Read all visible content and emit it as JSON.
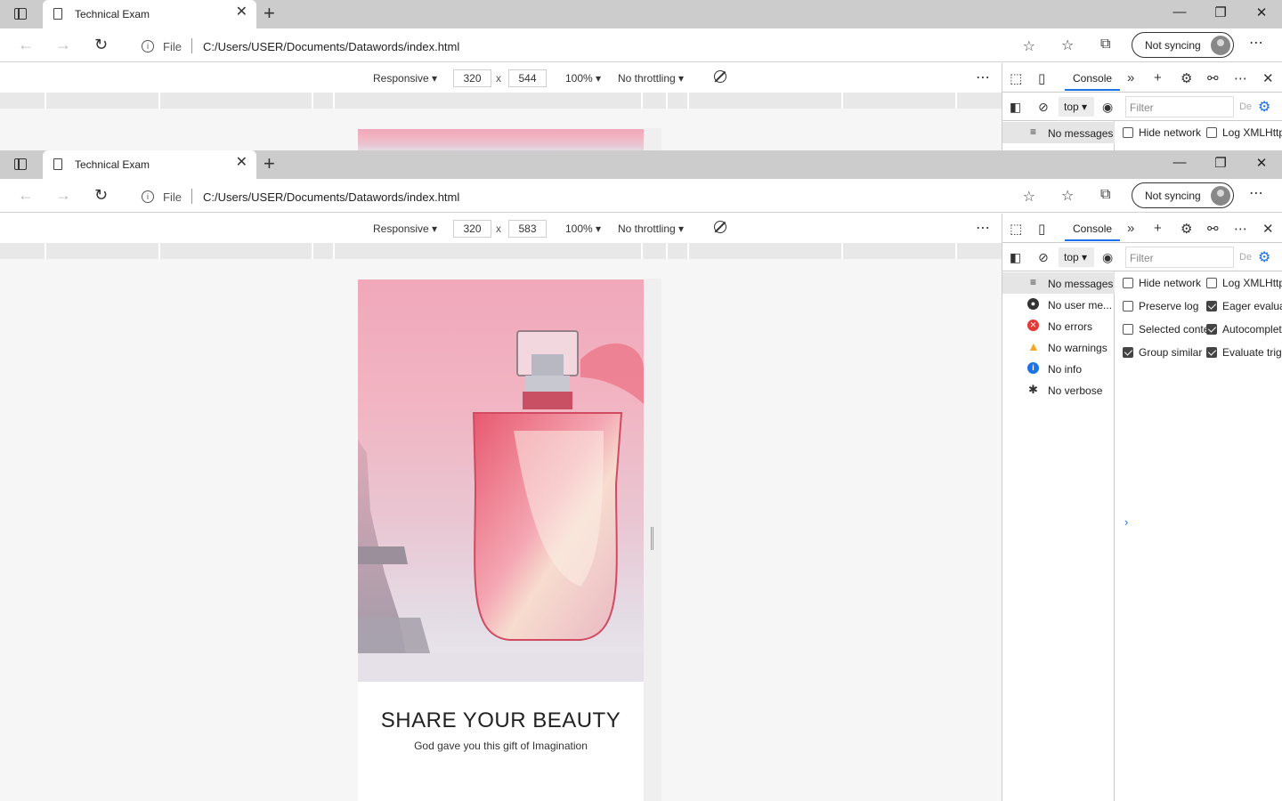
{
  "browser": {
    "tab_title": "Technical Exam",
    "address": {
      "scheme_label": "File",
      "url": "C:/Users/USER/Documents/Datawords/index.html"
    },
    "sync_label": "Not syncing"
  },
  "device_toolbar_back": {
    "device": "Responsive ▾",
    "width": "320",
    "height": "544",
    "times": "x",
    "zoom": "100% ▾",
    "throttling": "No throttling ▾"
  },
  "device_toolbar": {
    "device": "Responsive ▾",
    "width": "320",
    "height": "583",
    "times": "x",
    "zoom": "100% ▾",
    "throttling": "No throttling ▾"
  },
  "devtools": {
    "console_tab": "Console",
    "context": "top ▾",
    "filter_placeholder": "Filter",
    "default_levels": "De",
    "sidebar": [
      {
        "label": "No messages",
        "icon": "list-icon",
        "selected": true
      },
      {
        "label": "No user me...",
        "icon": "user-icon"
      },
      {
        "label": "No errors",
        "icon": "error-icon",
        "color": "#e53935"
      },
      {
        "label": "No warnings",
        "icon": "warning-icon",
        "color": "#f9a825"
      },
      {
        "label": "No info",
        "icon": "info-icon",
        "color": "#1a73e8"
      },
      {
        "label": "No verbose",
        "icon": "bug-icon"
      }
    ],
    "options_left": [
      {
        "label": "Hide network",
        "checked": false
      },
      {
        "label": "Preserve log",
        "checked": false
      },
      {
        "label": "Selected conte",
        "checked": false
      },
      {
        "label": "Group similar",
        "checked": true
      }
    ],
    "options_right": [
      {
        "label": "Log XMLHttp",
        "checked": false
      },
      {
        "label": "Eager evalua",
        "checked": true
      },
      {
        "label": "Autocomplet",
        "checked": true
      },
      {
        "label": "Evaluate trig",
        "checked": true
      }
    ],
    "prompt": "›"
  },
  "page": {
    "headline": "SHARE YOUR BEAUTY",
    "subline": "God gave you this gift of Imagination"
  },
  "colors": {
    "hero_pink": "#f0a8ba",
    "accent": "#1a73e8"
  }
}
